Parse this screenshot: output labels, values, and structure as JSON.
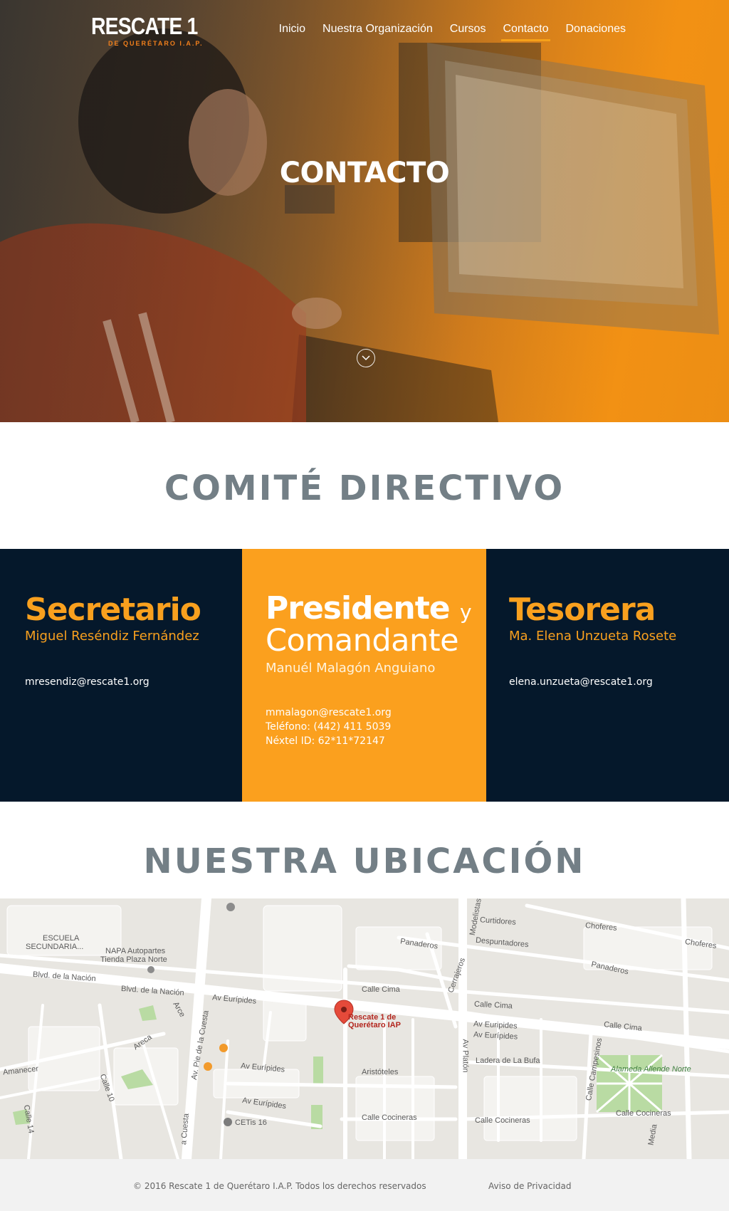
{
  "brand": {
    "name": "RESCATE 1",
    "sub": "DE QUERÉTARO I.A.P."
  },
  "nav": {
    "items": [
      "Inicio",
      "Nuestra Organización",
      "Cursos",
      "Contacto",
      "Donaciones"
    ],
    "active": "Contacto"
  },
  "hero": {
    "title": "CONTACTO"
  },
  "committee": {
    "title": "COMITÉ DIRECTIVO",
    "members": [
      {
        "role": "Secretario",
        "name": "Miguel Reséndiz Fernández",
        "email": "mresendiz@rescate1.org"
      },
      {
        "role": "Presidente",
        "role_joiner": "y",
        "role_line2": "Comandante",
        "name": "Manuél Malagón Anguiano",
        "email": "mmalagon@rescate1.org",
        "phone": "Teléfono: (442) 411 5039",
        "nextel": "Néxtel ID: 62*11*72147"
      },
      {
        "role": "Tesorera",
        "name": "Ma. Elena Unzueta Rosete",
        "email": "elena.unzueta@rescate1.org"
      }
    ]
  },
  "location": {
    "title": "NUESTRA UBICACIÓN",
    "map": {
      "marker_label_1": "Rescate 1 de",
      "marker_label_2": "Querétaro IAP",
      "labels": {
        "escuela": "ESCUELA",
        "escuela2": "SECUNDARIA...",
        "napa1": "NAPA Autopartes",
        "napa2": "Tienda Plaza Norte",
        "blvd1": "Blvd. de la Nación",
        "blvd2": "Blvd. de la Nación",
        "euripides1": "Av Eurípides",
        "euripides2": "Av Eurípides",
        "euripides3": "Av Eurípides",
        "euripides4": "Av Euripides",
        "euripides5": "Av Eurípides",
        "cuesta1": "Av. Pie de la Cuesta",
        "cuesta2": "a Cuesta",
        "arce": "Arce",
        "areca": "Areca",
        "amanecer": "Amanecer",
        "calle10": "Calle 10",
        "calle14": "Calle 14",
        "cetis": "CETis 16",
        "aristoteles": "Aristóteles",
        "cocineras1": "Calle Cocineras",
        "cocineras2": "Calle Cocineras",
        "cocineras3": "Calle Cocineras",
        "callecima1": "Calle Cima",
        "callecima2": "Calle Cima",
        "callecima3": "Calle Cima",
        "platon": "Av Platón",
        "ladera": "Ladera de La Bufa",
        "campesinos": "Calle Campesinos",
        "alameda": "Alameda Allende Norte",
        "panaderos1": "Panaderos",
        "panaderos2": "Panaderos",
        "modelistas": "Modelistas",
        "cerrajeros": "Cerrajeros",
        "curtidores": "Curtidores",
        "despuntadores": "Despuntadores",
        "choferes1": "Choferes",
        "choferes2": "Choferes",
        "media": "Media"
      }
    }
  },
  "footer": {
    "copyright": "© 2016 Rescate 1 de Querétaro I.A.P. Todos los derechos reservados",
    "privacy": "Aviso de Privacidad"
  },
  "colors": {
    "navy": "#05182b",
    "orange": "#fba01e",
    "title_gray": "#737f86"
  }
}
